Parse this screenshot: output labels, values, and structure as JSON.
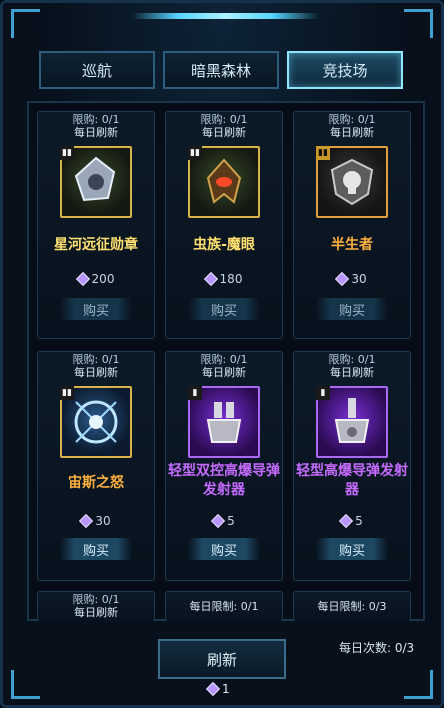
{
  "tabs": [
    {
      "label": "巡航",
      "active": false
    },
    {
      "label": "暗黑森林",
      "active": false
    },
    {
      "label": "竞技场",
      "active": true
    }
  ],
  "items": [
    {
      "limit": "限购: 0/1",
      "refresh": "每日刷新",
      "name": "星河远征勋章",
      "name_color": "#ffe070",
      "price": "200",
      "buy": "购买",
      "icon": "galaxy-medal-icon"
    },
    {
      "limit": "限购: 0/1",
      "refresh": "每日刷新",
      "name": "虫族-魔眼",
      "name_color": "#ffe070",
      "price": "180",
      "buy": "购买",
      "icon": "zerg-eye-icon"
    },
    {
      "limit": "限购: 0/1",
      "refresh": "每日刷新",
      "name": "半生者",
      "name_color": "#ffb040",
      "price": "30",
      "buy": "购买",
      "icon": "half-life-icon"
    },
    {
      "limit": "限购: 0/1",
      "refresh": "每日刷新",
      "name": "宙斯之怒",
      "name_color": "#ffb040",
      "price": "30",
      "buy": "购买",
      "icon": "zeus-wrath-icon"
    },
    {
      "limit": "限购: 0/1",
      "refresh": "每日刷新",
      "name": "轻型双控高爆导弹发射器",
      "name_color": "#c56bff",
      "price": "5",
      "buy": "购买",
      "icon": "dual-missile-launcher-icon"
    },
    {
      "limit": "限购: 0/1",
      "refresh": "每日刷新",
      "name": "轻型高爆导弹发射器",
      "name_color": "#c56bff",
      "price": "5",
      "buy": "购买",
      "icon": "missile-launcher-icon"
    }
  ],
  "bottom_row": [
    {
      "limit": "限购: 0/1",
      "refresh": "每日刷新"
    },
    {
      "refresh": "每日限制: 0/1"
    },
    {
      "refresh": "每日限制: 0/3"
    }
  ],
  "refresh_button": "刷新",
  "refresh_cost": "1",
  "daily_count": "每日次数: 0/3"
}
